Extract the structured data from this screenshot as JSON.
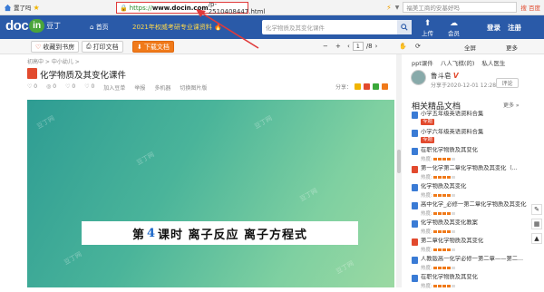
{
  "browser": {
    "back_label": "首页",
    "tab_label": "置了吗",
    "url_proto": "https://",
    "url_host": "www.docin.com",
    "url_path": "/p-2510408447.html",
    "ext_search_placeholder": "福美工商的安基好吗",
    "ext_right_label": "搜 百度"
  },
  "header": {
    "logo_doc": "doc",
    "logo_in": "in",
    "logo_cn": "豆丁",
    "home_label": "首页",
    "promo_text": "2021年权威考研专业课资料 🔥",
    "search_placeholder": "化学物质及其变化课件",
    "upload_label": "上传",
    "vip_label": "会员",
    "login_label": "登录",
    "register_label": "注册"
  },
  "toolbar": {
    "collect_label": "收藏到书房",
    "print_label": "打印文档",
    "download_label": "下载文档",
    "page_current": "1",
    "page_total": "/8",
    "fullscreen_label": "全屏",
    "more_label": "更多"
  },
  "document": {
    "breadcrumb": "初高中 > 中小幼儿 >",
    "title": "化学物质及其变化课件",
    "meta": [
      "♡ 0",
      "◎ 0",
      "♡ 0",
      "♡ 0",
      "加入豆单",
      "举报",
      "多机器",
      "切换图片版"
    ],
    "share_label": "分享：",
    "slide_prefix": "第",
    "slide_num": "4",
    "slide_text": "课时 离子反应 离子方程式",
    "watermark": "豆丁网"
  },
  "sidebar": {
    "tabs": [
      "ppt课件",
      "八人飞棋(的)",
      "私人医生"
    ],
    "author_name": "鲁斗皂",
    "author_badge": "V",
    "author_date": "分享于2020-12-01 12:28",
    "follow_label": "评论",
    "related_title": "相关精品文档",
    "more_label": "更多 »",
    "rating_label": "热度:",
    "items": [
      {
        "text": "小学五年级英语资料合集",
        "tag": "专题"
      },
      {
        "text": "小学六年级英语资料合集",
        "tag": "专题"
      },
      {
        "text": "在职化学物质及其变化",
        "tag": ""
      },
      {
        "text": "第一化学第二章化学物质及其变化（...",
        "tag": ""
      },
      {
        "text": "化学物质及其变化",
        "tag": ""
      },
      {
        "text": "高中化学_必修一第二章化学物质及其变化",
        "tag": ""
      },
      {
        "text": "化学物质及其变化教案",
        "tag": ""
      },
      {
        "text": "第二章化学物质及其变化",
        "tag": ""
      },
      {
        "text": "人教版高一化学必修一第二章——第二...",
        "tag": ""
      },
      {
        "text": "在职化学物质及其变化",
        "tag": ""
      }
    ]
  },
  "colors": {
    "header_bg": "#2a5aa8",
    "download_btn": "#f07a1a",
    "annotation_red": "#e03a3a",
    "slide_gradient_start": "#2e9c93",
    "slide_gradient_end": "#9bd9a2"
  }
}
